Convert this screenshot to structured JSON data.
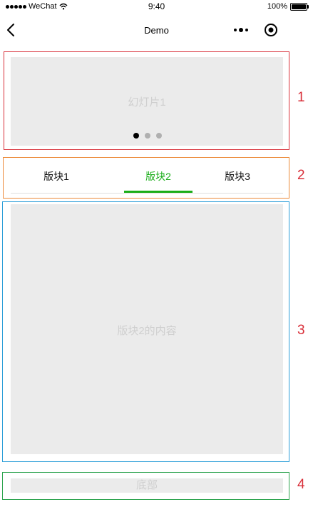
{
  "status_bar": {
    "carrier": "WeChat",
    "time": "9:40",
    "battery": "100%",
    "battery_level": 1.0
  },
  "nav": {
    "title": "Demo",
    "back_icon": "chevron-left-icon",
    "more_icon": "more-dots-icon",
    "home_icon": "target-circle-icon"
  },
  "section_numbers": [
    "1",
    "2",
    "3",
    "4"
  ],
  "slider": {
    "label": "幻灯片1",
    "indicator_count": 3,
    "active_index": 0
  },
  "tabs": [
    {
      "label": "版块1"
    },
    {
      "label": "版块2"
    },
    {
      "label": "版块3"
    }
  ],
  "active_tab": 1,
  "content": {
    "label": "版块2的内容"
  },
  "footer": {
    "label": "底部"
  },
  "colors": {
    "accent_green": "#1aad19",
    "box_red": "#d9303a",
    "box_orange": "#ec8b3a",
    "box_blue": "#2c9ed8",
    "box_green": "#2ea44f",
    "placeholder_bg": "#ebebeb",
    "placeholder_text": "#cfcfcf"
  }
}
